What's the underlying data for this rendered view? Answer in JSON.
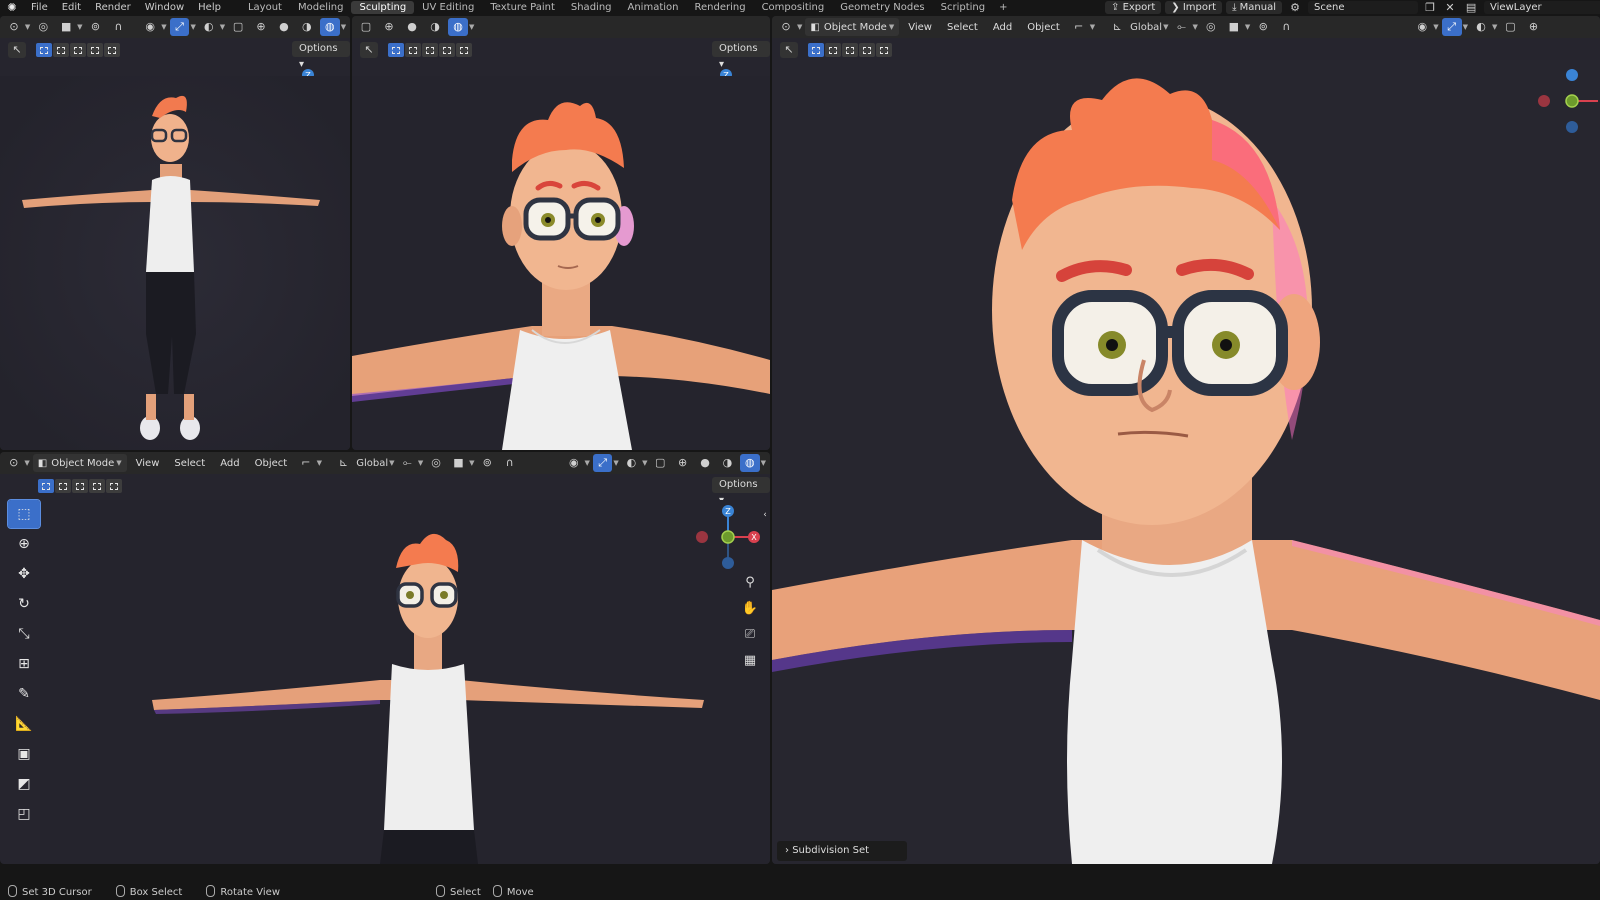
{
  "topbar": {
    "logo": "blender-logo-icon",
    "menus": [
      "File",
      "Edit",
      "Render",
      "Window",
      "Help"
    ],
    "workspaces": [
      "Layout",
      "Modeling",
      "Sculpting",
      "UV Editing",
      "Texture Paint",
      "Shading",
      "Animation",
      "Rendering",
      "Compositing",
      "Geometry Nodes",
      "Scripting"
    ],
    "active_workspace": "Sculpting",
    "add_workspace": "+",
    "export_label": "Export",
    "import_label": "Import",
    "manual_label": "Manual",
    "scene": "Scene",
    "view_layer": "ViewLayer"
  },
  "viewport_header": {
    "mode": "Object Mode",
    "view": "View",
    "select": "Select",
    "add": "Add",
    "object": "Object",
    "orientation": "Global",
    "options": "Options"
  },
  "gizmo": {
    "z": "Z",
    "y": "Y",
    "x": "X",
    "colors": {
      "x": "#d9414f",
      "y": "#7db32f",
      "z": "#3a84d6"
    }
  },
  "toolbar_icons": [
    "select-box-icon",
    "cursor-icon",
    "move-icon",
    "rotate-icon",
    "scale-icon",
    "transform-icon",
    "annotate-icon",
    "measure-icon",
    "add-cube-icon",
    "shear-icon",
    "spin-icon"
  ],
  "operator_panel": {
    "label": "Subdivision Set"
  },
  "statusbar": {
    "item1": "Set 3D Cursor",
    "item2": "Box Select",
    "item3": "Rotate View",
    "item4": "Select",
    "item5": "Move"
  },
  "colors": {
    "accent": "#3b6fc9",
    "viewport_bg": "#26252e",
    "header_bg": "#282828"
  }
}
